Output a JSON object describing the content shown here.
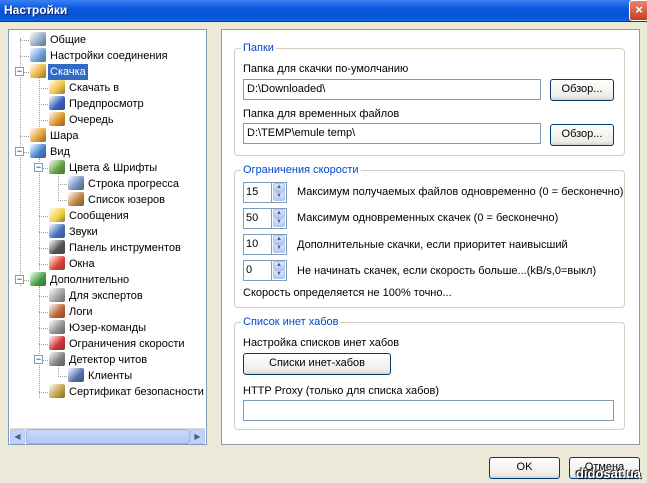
{
  "window": {
    "title": "Настройки",
    "close": "×"
  },
  "tree": {
    "items": [
      {
        "label": "Общие",
        "icon": "general-icon",
        "color": "#8fa8c8"
      },
      {
        "label": "Настройки соединения",
        "icon": "connection-icon",
        "color": "#6aa0d8"
      },
      {
        "label": "Скачка",
        "icon": "download-icon",
        "color": "#e8b030",
        "selected": true
      },
      {
        "label": "Скачать в",
        "icon": "folder-download-icon",
        "color": "#f0c040"
      },
      {
        "label": "Предпросмотр",
        "icon": "preview-icon",
        "color": "#3060c0"
      },
      {
        "label": "Очередь",
        "icon": "queue-icon",
        "color": "#e09020"
      },
      {
        "label": "Шара",
        "icon": "share-icon",
        "color": "#e0a030"
      },
      {
        "label": "Вид",
        "icon": "view-icon",
        "color": "#4080d0"
      },
      {
        "label": "Цвета & Шрифты",
        "icon": "colors-fonts-icon",
        "color": "#60a040"
      },
      {
        "label": "Строка прогресса",
        "icon": "progress-bar-icon",
        "color": "#7090c0"
      },
      {
        "label": "Список юзеров",
        "icon": "user-list-icon",
        "color": "#c08040"
      },
      {
        "label": "Сообщения",
        "icon": "messages-icon",
        "color": "#f0d040"
      },
      {
        "label": "Звуки",
        "icon": "sounds-icon",
        "color": "#4070c0"
      },
      {
        "label": "Панель инструментов",
        "icon": "toolbar-icon",
        "color": "#505050"
      },
      {
        "label": "Окна",
        "icon": "windows-icon",
        "color": "#e04030"
      },
      {
        "label": "Дополнительно",
        "icon": "advanced-icon",
        "color": "#40a040"
      },
      {
        "label": "Для экспертов",
        "icon": "expert-icon",
        "color": "#a0a0a0"
      },
      {
        "label": "Логи",
        "icon": "logs-icon",
        "color": "#c06030"
      },
      {
        "label": "Юзер-команды",
        "icon": "user-commands-icon",
        "color": "#909090"
      },
      {
        "label": "Ограничения скорости",
        "icon": "speed-limit-icon",
        "color": "#d03030"
      },
      {
        "label": "Детектор читов",
        "icon": "cheat-detector-icon",
        "color": "#808080"
      },
      {
        "label": "Клиенты",
        "icon": "clients-icon",
        "color": "#5070b0"
      },
      {
        "label": "Сертификат безопасности",
        "icon": "certificate-icon",
        "color": "#c0a040"
      }
    ],
    "scroll_left": "◀",
    "scroll_right": "▶"
  },
  "folders": {
    "title": "Папки",
    "default_label": "Папка для скачки по-умолчанию",
    "default_value": "D:\\Downloaded\\",
    "temp_label": "Папка для временных файлов",
    "temp_value": "D:\\TEMP\\emule temp\\",
    "browse": "Обзор..."
  },
  "speed": {
    "title": "Ограничения скорости",
    "rows": [
      {
        "value": "15",
        "label": "Максимум получаемых файлов одновременно (0 = бесконечно)"
      },
      {
        "value": "50",
        "label": "Максимум одновременных скачек (0 = бесконечно)"
      },
      {
        "value": "10",
        "label": "Дополнительные скачки, если приоритет наивысший"
      },
      {
        "value": "0",
        "label": "Не начинать скачек, если скорость больше...(kB/s,0=выкл)"
      }
    ],
    "note": "Скорость определяется не 100% точно...",
    "up": "▲",
    "down": "▼"
  },
  "hubs": {
    "title": "Список инет хабов",
    "config_label": "Настройка списков инет хабов",
    "button": "Списки инет-хабов",
    "proxy_label": "HTTP Proxy (только для списка хабов)",
    "proxy_value": ""
  },
  "buttons": {
    "ok": "OK",
    "cancel": "Отмена"
  },
  "watermark": "didosat.ua"
}
